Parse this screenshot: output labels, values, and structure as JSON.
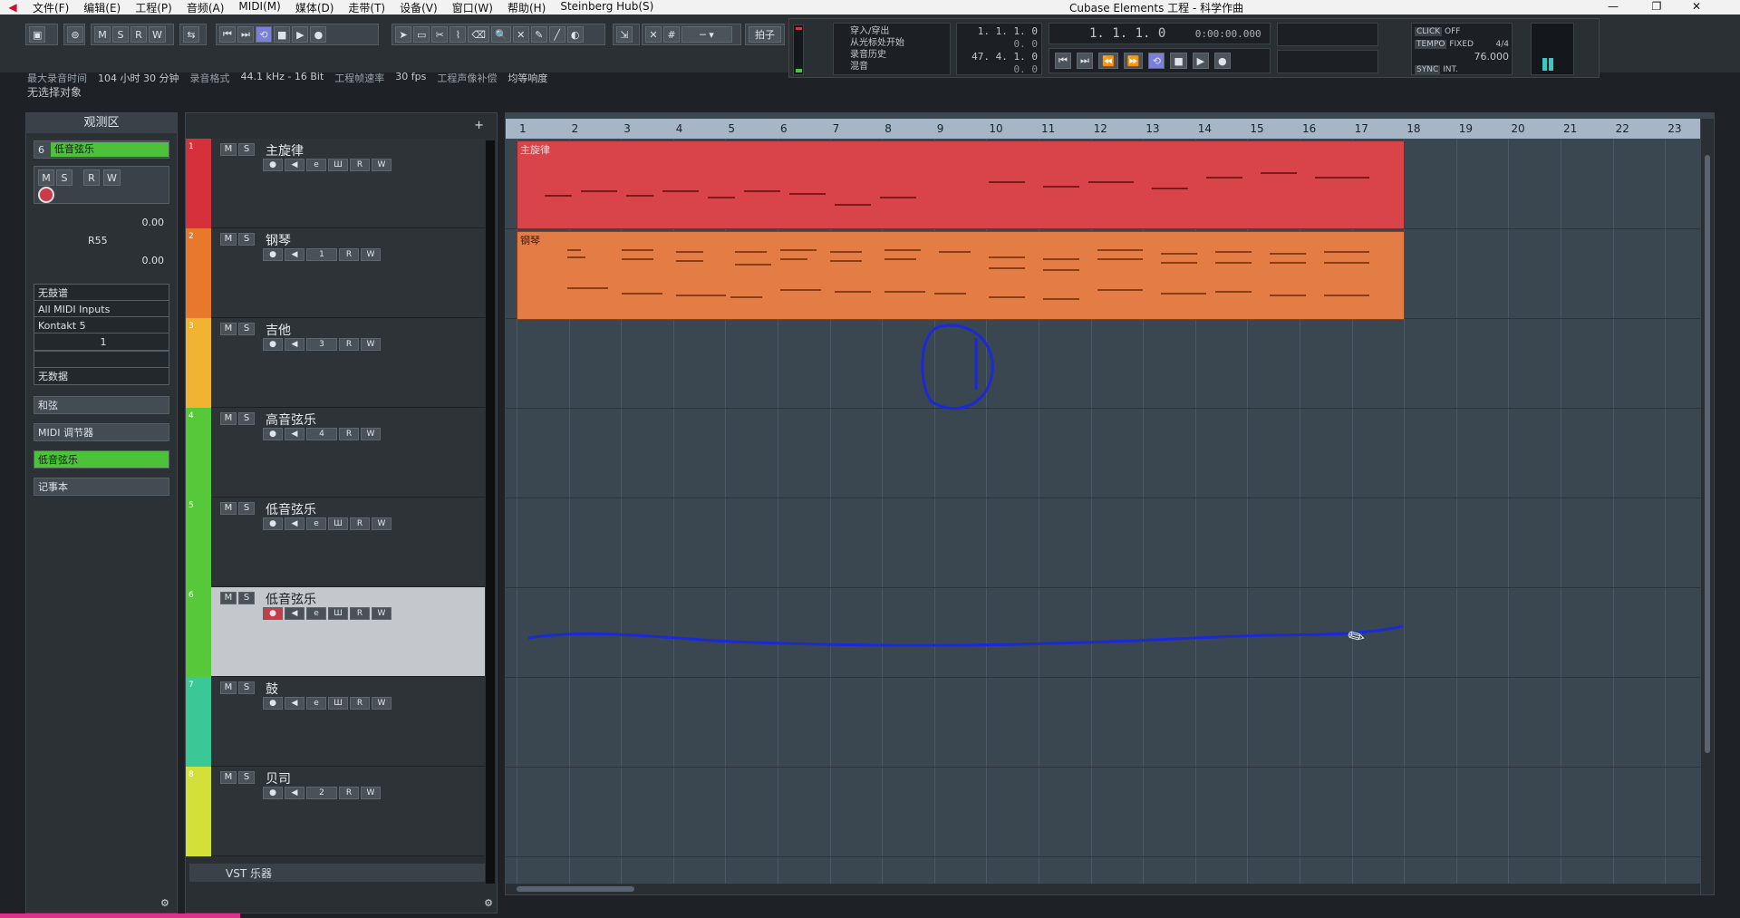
{
  "window": {
    "title": "Cubase Elements 工程 - 科学作曲",
    "menu": [
      "文件(F)",
      "编辑(E)",
      "工程(P)",
      "音频(A)",
      "MIDI(M)",
      "媒体(D)",
      "走带(T)",
      "设备(V)",
      "窗口(W)",
      "帮助(H)",
      "Steinberg Hub(S)"
    ],
    "controls": {
      "minimize": "—",
      "restore": "❐",
      "close": "✕"
    }
  },
  "toolbar": {
    "ms_buttons": [
      "M",
      "S",
      "R",
      "W"
    ],
    "tempo_track_label": "拍子",
    "info": [
      {
        "label": "最大录音时间",
        "value": "104 小时 30 分钟"
      },
      {
        "label": "录音格式",
        "value": "44.1 kHz - 16 Bit"
      },
      {
        "label": "工程帧速率",
        "value": "30 fps"
      },
      {
        "label": "工程声像补偿",
        "value": "均等响度"
      }
    ]
  },
  "transport": {
    "mode_list": [
      "穿入/穿出",
      "从光标处开始",
      "录音历史",
      "混音"
    ],
    "locator_left": "1. 1. 1.   0",
    "locator_right": "47. 4. 1.   0",
    "primary_time": "1. 1. 1.   0",
    "secondary_time": "0:00:00.000",
    "click": "CLICK",
    "click_state": "OFF",
    "tempo_label": "TEMPO",
    "tempo_mode": "FIXED",
    "signature": "4/4",
    "tempo_value": "76.000",
    "sync_label": "SYNC",
    "sync_mode": "INT."
  },
  "status": {
    "selection": "无选择对象"
  },
  "inspector": {
    "title": "观测区",
    "track_number": "6",
    "track_name": "低音弦乐",
    "volume": "0.00",
    "pan": "R55",
    "delay": "0.00",
    "no_drum_map": "无鼓谱",
    "input": "All MIDI Inputs",
    "output": "Kontakt 5",
    "channel": "1",
    "no_bank": "无数据",
    "sections": [
      "和弦",
      "MIDI 调节器",
      "低音弦乐",
      "记事本"
    ]
  },
  "tracks": [
    {
      "num": "1",
      "name": "主旋律",
      "color": "#d6303a",
      "type": "midi"
    },
    {
      "num": "2",
      "name": "钢琴",
      "color": "#e8782c",
      "type": "instrument",
      "ch": "1"
    },
    {
      "num": "3",
      "name": "吉他",
      "color": "#f0b432",
      "type": "instrument",
      "ch": "3"
    },
    {
      "num": "4",
      "name": "高音弦乐",
      "color": "#56c83a",
      "type": "instrument",
      "ch": "4"
    },
    {
      "num": "5",
      "name": "低音弦乐",
      "color": "#56c83a",
      "type": "midi"
    },
    {
      "num": "6",
      "name": "低音弦乐",
      "color": "#56c83a",
      "type": "midi",
      "selected": true
    },
    {
      "num": "7",
      "name": "鼓",
      "color": "#3ac896",
      "type": "midi"
    },
    {
      "num": "8",
      "name": "贝司",
      "color": "#d4e03a",
      "type": "instrument",
      "ch": "2"
    }
  ],
  "vst_folder": "VST 乐器",
  "arrange": {
    "bars": [
      "1",
      "2",
      "3",
      "4",
      "5",
      "6",
      "7",
      "8",
      "9",
      "10",
      "11",
      "12",
      "13",
      "14",
      "15",
      "16",
      "17",
      "18",
      "19",
      "20",
      "21",
      "22",
      "23"
    ],
    "parts": [
      {
        "name": "主旋律",
        "color": "#d8444a"
      },
      {
        "name": "钢琴",
        "color": "#e47c46"
      }
    ]
  },
  "colors": {
    "accent": "#7a7fdc",
    "record": "#c83b4a",
    "annotation": "#1a2ad8"
  }
}
